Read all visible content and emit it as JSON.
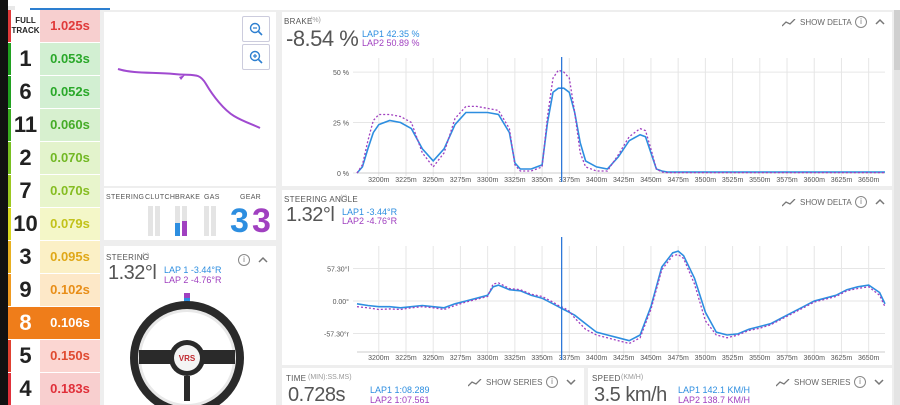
{
  "ranking": {
    "items": [
      {
        "label": "FULL TRACK",
        "time": "1.025s",
        "bg": "#f7cfcf",
        "fg": "#e03a3a",
        "bar": "#e03a3a",
        "full": true
      },
      {
        "label": "1",
        "time": "0.053s",
        "bg": "#d2efd2",
        "fg": "#2aa82a",
        "bar": "#20a020"
      },
      {
        "label": "6",
        "time": "0.052s",
        "bg": "#d2efd2",
        "fg": "#2aa82a",
        "bar": "#20a020"
      },
      {
        "label": "11",
        "time": "0.060s",
        "bg": "#d7f0cf",
        "fg": "#46ac28",
        "bar": "#3aac20"
      },
      {
        "label": "2",
        "time": "0.070s",
        "bg": "#e3f3cc",
        "fg": "#72b824",
        "bar": "#78c020"
      },
      {
        "label": "7",
        "time": "0.070s",
        "bg": "#e8f5cc",
        "fg": "#86bd22",
        "bar": "#9cc820"
      },
      {
        "label": "10",
        "time": "0.079s",
        "bg": "#f4f7c8",
        "fg": "#c2c21a",
        "bar": "#d8d820"
      },
      {
        "label": "3",
        "time": "0.095s",
        "bg": "#fbf0c6",
        "fg": "#e0a818",
        "bar": "#e8b020"
      },
      {
        "label": "9",
        "time": "0.102s",
        "bg": "#fde8c8",
        "fg": "#e88e18",
        "bar": "#ef9a20"
      },
      {
        "label": "8",
        "time": "0.106s",
        "bg": "#ef7d1a",
        "fg": "#ffffff",
        "bar": "#ef7d1a",
        "active": true
      },
      {
        "label": "5",
        "time": "0.150s",
        "bg": "#fbd6d2",
        "fg": "#e04a30",
        "bar": "#e04030"
      },
      {
        "label": "4",
        "time": "0.183s",
        "bg": "#f8cfcf",
        "fg": "#e0303a",
        "bar": "#e0303a"
      }
    ]
  },
  "inputs": {
    "labels": [
      "STEERING",
      "CLUTCH",
      "BRAKE",
      "GAS"
    ],
    "gear_label": "GEAR",
    "gear_lap1": "3",
    "gear_lap2": "3"
  },
  "steering_card": {
    "title": "STEERING",
    "unit": "(°)",
    "value": "1.32°l",
    "lap1": "LAP 1 -3.44°R",
    "lap2": "LAP 2 -4.76°R",
    "wheel_logo": "VRS"
  },
  "brake_chart": {
    "title": "BRAKE",
    "unit": "(%)",
    "value": "-8.54 %",
    "lap1": "LAP1 42.35 %",
    "lap2": "LAP2 50.89 %",
    "show_delta": "SHOW DELTA",
    "y_ticks": [
      "50 %",
      "25 %",
      "0 %"
    ]
  },
  "steering_chart": {
    "title": "STEERING ANGLE",
    "unit": "(°)",
    "value": "1.32°l",
    "lap1": "LAP1 -3.44°R",
    "lap2": "LAP2 -4.76°R",
    "show_delta": "SHOW DELTA",
    "y_ticks": [
      "57.30°l",
      "0.00°",
      "-57.30°r"
    ]
  },
  "x_axis": [
    "3200m",
    "3225m",
    "3250m",
    "3275m",
    "3300m",
    "3325m",
    "3350m",
    "3375m",
    "3400m",
    "3425m",
    "3450m",
    "3475m",
    "3500m",
    "3525m",
    "3550m",
    "3575m",
    "3600m",
    "3625m",
    "3650m"
  ],
  "time_card": {
    "title": "TIME",
    "unit": "(MIN):SS.MS)",
    "value": "0.728s",
    "lap1": "LAP1 1:08.289",
    "lap2": "LAP2 1:07.561",
    "show_series": "SHOW SERIES"
  },
  "speed_card": {
    "title": "SPEED",
    "unit": "(KM/H)",
    "value": "3.5 km/h",
    "lap1": "LAP1 142.1 KM/H",
    "lap2": "LAP2 138.7 KM/H",
    "show_series": "SHOW SERIES"
  },
  "colors": {
    "lap1": "#2d8ee0",
    "lap2": "#a040c0",
    "cursor": "#1f6fd6"
  },
  "chart_data": [
    {
      "type": "line",
      "title": "BRAKE",
      "ylabel": "(%)",
      "ylim": [
        0,
        55
      ],
      "x": [
        3180,
        3185,
        3190,
        3195,
        3200,
        3210,
        3220,
        3230,
        3240,
        3250,
        3260,
        3270,
        3280,
        3290,
        3300,
        3310,
        3320,
        3325,
        3330,
        3340,
        3350,
        3355,
        3360,
        3365,
        3370,
        3375,
        3380,
        3385,
        3390,
        3400,
        3410,
        3420,
        3430,
        3440,
        3445,
        3450,
        3455,
        3460,
        3465,
        3470,
        3475,
        3500,
        3550,
        3600,
        3650,
        3665
      ],
      "series": [
        {
          "name": "LAP1",
          "values": [
            0,
            3,
            12,
            20,
            24,
            26,
            25,
            22,
            12,
            6,
            12,
            24,
            30,
            30,
            30,
            29,
            20,
            5,
            2,
            2,
            4,
            25,
            40,
            42,
            42,
            40,
            30,
            15,
            6,
            3,
            2,
            8,
            16,
            19,
            18,
            10,
            2,
            1,
            0.5,
            0.5,
            0.5,
            0.5,
            0.5,
            0.5,
            0.5,
            0.5
          ]
        },
        {
          "name": "LAP2",
          "values": [
            0,
            4,
            16,
            26,
            29,
            29,
            28,
            25,
            10,
            3,
            10,
            27,
            33,
            33,
            32,
            31,
            22,
            4,
            1,
            1,
            3,
            28,
            47,
            51,
            50,
            47,
            30,
            10,
            3,
            1,
            1,
            9,
            18,
            22,
            21,
            12,
            2,
            0.5,
            0.2,
            0.2,
            0.2,
            0.2,
            0.2,
            0.2,
            0.2,
            0.2
          ]
        }
      ]
    },
    {
      "type": "line",
      "title": "STEERING ANGLE",
      "ylabel": "(°)",
      "ylim": [
        -90,
        90
      ],
      "x": [
        3180,
        3190,
        3200,
        3210,
        3220,
        3230,
        3240,
        3250,
        3260,
        3270,
        3280,
        3290,
        3300,
        3305,
        3310,
        3320,
        3330,
        3340,
        3350,
        3360,
        3365,
        3370,
        3375,
        3380,
        3390,
        3400,
        3410,
        3420,
        3430,
        3440,
        3450,
        3460,
        3470,
        3475,
        3480,
        3490,
        3500,
        3510,
        3520,
        3530,
        3540,
        3550,
        3560,
        3570,
        3580,
        3590,
        3600,
        3610,
        3620,
        3630,
        3640,
        3650,
        3660,
        3665
      ],
      "series": [
        {
          "name": "LAP1",
          "values": [
            -5,
            -8,
            -10,
            -10,
            -12,
            -10,
            -8,
            -10,
            -12,
            -5,
            0,
            5,
            10,
            25,
            28,
            20,
            18,
            10,
            5,
            -5,
            -10,
            -15,
            -20,
            -25,
            -40,
            -55,
            -60,
            -65,
            -70,
            -60,
            -10,
            60,
            85,
            88,
            80,
            40,
            -20,
            -55,
            -60,
            -58,
            -50,
            -45,
            -40,
            -30,
            -20,
            -10,
            0,
            5,
            10,
            20,
            25,
            28,
            15,
            -5
          ]
        },
        {
          "name": "LAP2",
          "values": [
            -10,
            -12,
            -15,
            -14,
            -15,
            -12,
            -10,
            -12,
            -15,
            -8,
            -2,
            3,
            8,
            30,
            32,
            22,
            20,
            12,
            8,
            -2,
            -8,
            -12,
            -18,
            -30,
            -50,
            -60,
            -65,
            -70,
            -75,
            -65,
            -15,
            55,
            80,
            82,
            75,
            30,
            -35,
            -60,
            -65,
            -60,
            -52,
            -48,
            -42,
            -32,
            -22,
            -12,
            -2,
            3,
            8,
            18,
            22,
            25,
            10,
            -10
          ]
        }
      ]
    }
  ]
}
